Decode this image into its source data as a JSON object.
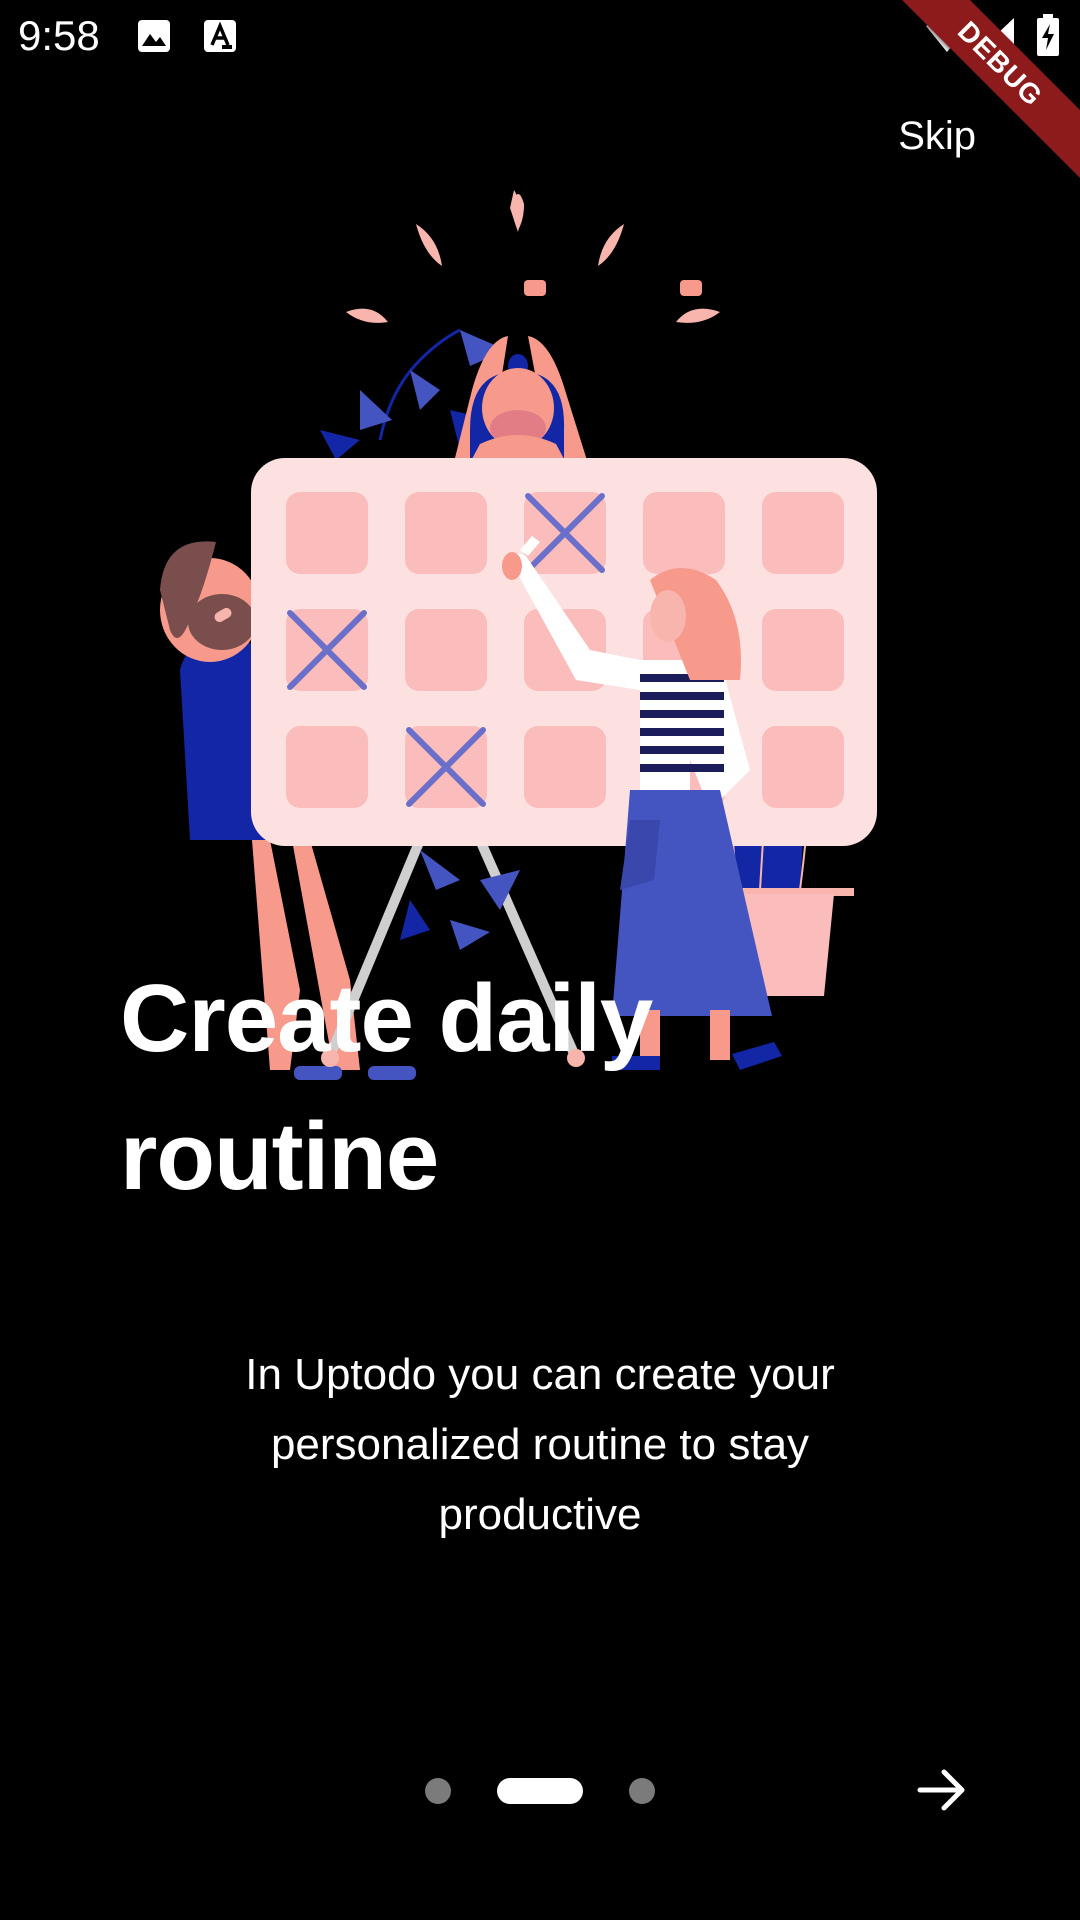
{
  "status_bar": {
    "time": "9:58",
    "icons": [
      "image-icon",
      "text-recognition-icon",
      "wifi-icon",
      "signal-icon",
      "battery-charging-icon"
    ]
  },
  "debug_banner": "DEBUG",
  "skip_label": "Skip",
  "onboarding": {
    "title_line1": "Create daily",
    "title_line2": "routine",
    "description_line1": "In Uptodo you can create your",
    "description_line2": "personalized routine to stay",
    "description_line3": "productive",
    "page_indicator": {
      "count": 3,
      "active_index": 1
    }
  },
  "colors": {
    "background": "#000000",
    "board": "#fde0e0",
    "cell": "#fbbcbc",
    "mark": "#6a6fc9",
    "blue": "#1326a5",
    "skin": "#f79a8c",
    "inactive_dot": "#7b7b7b"
  }
}
